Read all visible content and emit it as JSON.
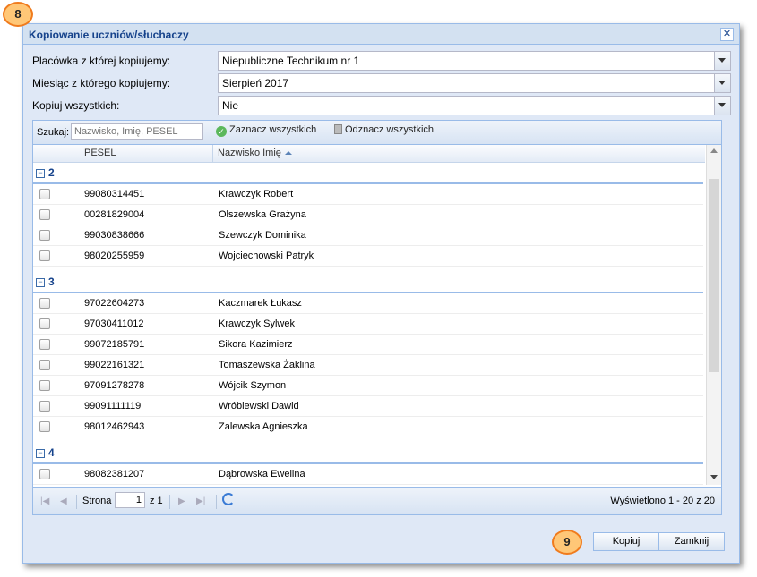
{
  "window": {
    "title": "Kopiowanie uczniów/słuchaczy",
    "close_glyph": "✕"
  },
  "form": {
    "placowka_label": "Placówka z której kopiujemy:",
    "placowka_value": "Niepubliczne Technikum nr 1",
    "miesiac_label": "Miesiąc z którego kopiujemy:",
    "miesiac_value": "Sierpień 2017",
    "kopiuj_label": "Kopiuj wszystkich:",
    "kopiuj_value": "Nie"
  },
  "toolbar": {
    "search_label": "Szukaj:",
    "search_placeholder": "Nazwisko, Imię, PESEL",
    "select_all": "Zaznacz wszystkich",
    "deselect_all": "Odznacz wszystkich"
  },
  "grid": {
    "columns": [
      "PESEL",
      "Nazwisko Imię"
    ],
    "groups": [
      {
        "name": "2",
        "rows": [
          {
            "pesel": "99080314451",
            "name": "Krawczyk Robert"
          },
          {
            "pesel": "00281829004",
            "name": "Olszewska Grażyna"
          },
          {
            "pesel": "99030838666",
            "name": "Szewczyk Dominika"
          },
          {
            "pesel": "98020255959",
            "name": "Wojciechowski Patryk"
          }
        ]
      },
      {
        "name": "3",
        "rows": [
          {
            "pesel": "97022604273",
            "name": "Kaczmarek Łukasz"
          },
          {
            "pesel": "97030411012",
            "name": "Krawczyk Sylwek"
          },
          {
            "pesel": "99072185791",
            "name": "Sikora Kazimierz"
          },
          {
            "pesel": "99022161321",
            "name": "Tomaszewska Żaklina"
          },
          {
            "pesel": "97091278278",
            "name": "Wójcik Szymon"
          },
          {
            "pesel": "99091111119",
            "name": "Wróblewski Dawid"
          },
          {
            "pesel": "98012462943",
            "name": "Zalewska Agnieszka"
          }
        ]
      },
      {
        "name": "4",
        "rows": [
          {
            "pesel": "98082381207",
            "name": "Dąbrowska Ewelina"
          }
        ]
      }
    ]
  },
  "paging": {
    "page_label": "Strona",
    "page_value": "1",
    "of_label": "z 1",
    "info": "Wyświetlono 1 - 20 z 20"
  },
  "buttons": {
    "copy": "Kopiuj",
    "close": "Zamknij"
  },
  "callouts": {
    "top": "8",
    "bottom": "9"
  },
  "colors": {
    "title": "#15428b",
    "border": "#99bbe8",
    "callout_fill": "#ffc777",
    "callout_border": "#f07b1d"
  }
}
